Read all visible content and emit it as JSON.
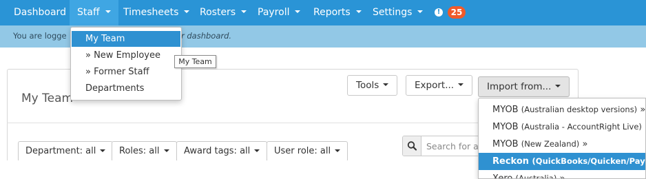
{
  "nav": {
    "items": [
      {
        "label": "Dashboard",
        "caret": false
      },
      {
        "label": "Staff",
        "caret": true
      },
      {
        "label": "Timesheets",
        "caret": true
      },
      {
        "label": "Rosters",
        "caret": true
      },
      {
        "label": "Payroll",
        "caret": true
      },
      {
        "label": "Reports",
        "caret": true
      },
      {
        "label": "Settings",
        "caret": true
      }
    ],
    "alert_icon": "!",
    "badge_count": "25",
    "colors": {
      "bar": "#2a94d6",
      "active": "#3fa6e3",
      "badge": "#f05a2a"
    }
  },
  "infobar": {
    "text_start": "You are logge",
    "text_end": "r dashboard."
  },
  "staff_menu": {
    "items": [
      "My Team",
      "» New Employee",
      "» Former Staff",
      "Departments"
    ],
    "active_index": 0,
    "tooltip": "My Team"
  },
  "page": {
    "title": "My Team"
  },
  "toolbar": {
    "tools": "Tools",
    "export": "Export...",
    "import": "Import from..."
  },
  "filters": [
    "Department: all",
    "Roles: all",
    "Award tags: all",
    "User role: all"
  ],
  "search": {
    "placeholder": "Search for an"
  },
  "import_menu": {
    "items": [
      {
        "main": "MYOB",
        "sub": "(Australian desktop versions)",
        "arrow": "»"
      },
      {
        "main": "MYOB",
        "sub": "(Australia - AccountRight Live)",
        "arrow": "»"
      },
      {
        "main": "MYOB",
        "sub": "(New Zealand)",
        "arrow": "»"
      },
      {
        "main": "Reckon",
        "sub": "(QuickBooks/Quicken/Payroll",
        "arrow": ""
      },
      {
        "main": "Xero",
        "sub": "(Australia)",
        "arrow": "»"
      }
    ],
    "active_index": 3,
    "accent": "#2f91d1"
  }
}
